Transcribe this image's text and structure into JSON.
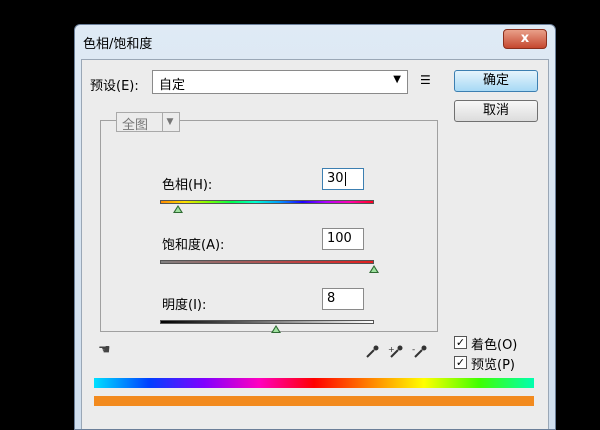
{
  "dialog": {
    "title": "色相/饱和度",
    "close_label": "x"
  },
  "preset": {
    "label": "预设(E):",
    "value": "自定"
  },
  "buttons": {
    "ok": "确定",
    "cancel": "取消"
  },
  "channel": {
    "value": "全图"
  },
  "hue": {
    "label": "色相(H):",
    "value": "30",
    "level_fraction": 0.083
  },
  "saturation": {
    "label": "饱和度(A):",
    "value": "100",
    "level_fraction": 1.0
  },
  "lightness": {
    "label": "明度(I):",
    "value": "8",
    "level_fraction": 0.54
  },
  "options": {
    "colorize": "着色(O)",
    "preview": "预览(P)"
  },
  "icons": [
    "menu-icon",
    "hand-adjust-icon",
    "eyedropper-icon",
    "eyedropper-plus-icon",
    "eyedropper-minus-icon",
    "check-icon"
  ],
  "colors": {
    "ok_accent": "#a7d9f5",
    "colorize_bar": "#f28a1e"
  }
}
